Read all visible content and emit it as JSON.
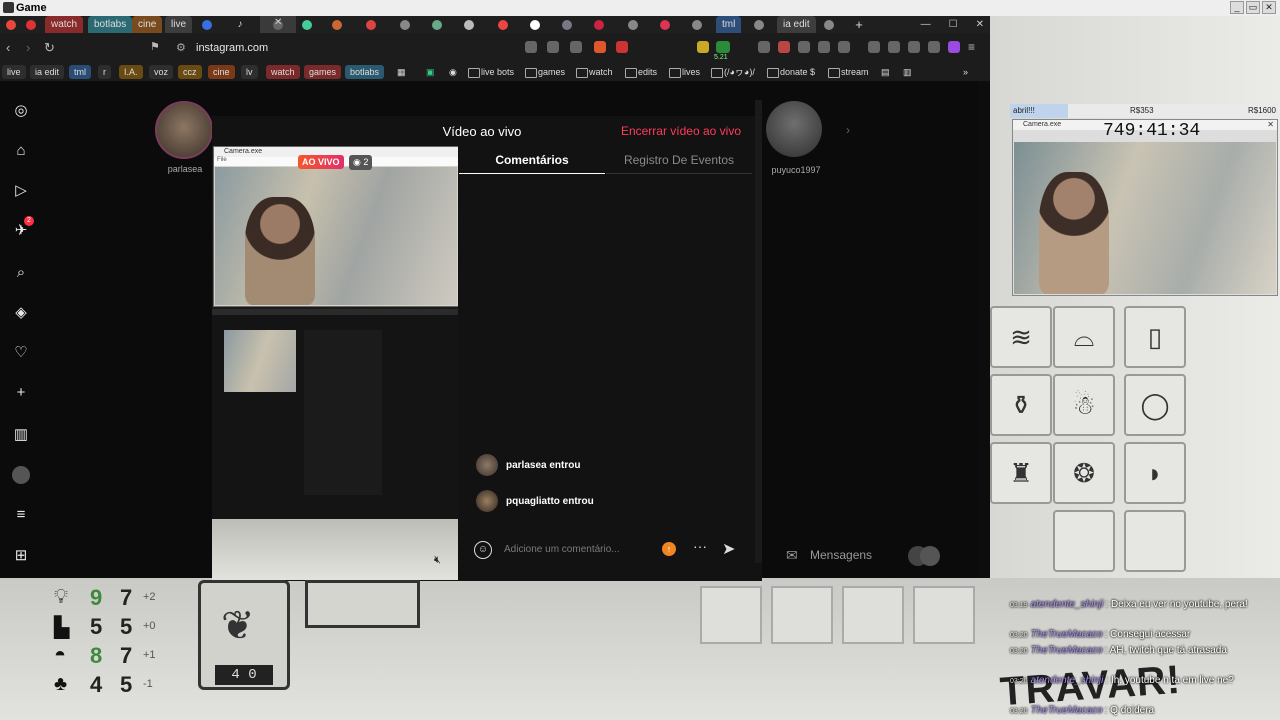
{
  "os": {
    "title": "Game",
    "ctrl_min": "_",
    "ctrl_max": "▭",
    "ctrl_close": "✕"
  },
  "browser": {
    "tabs": [
      "watch",
      "botlabs",
      "cine",
      "live",
      "tml",
      "ia edit"
    ],
    "address": "instagram.com",
    "extension_badge": "5.21",
    "bookmarks": [
      "live",
      "ia edit",
      "tml",
      "r",
      "I.A.",
      "voz",
      "ccz",
      "cine",
      "lv",
      "watch",
      "games",
      "botlabs"
    ],
    "bookmark_folders": [
      "live bots",
      "games",
      "watch",
      "edits",
      "lives",
      "(/◕ヮ◕)/",
      "donate $",
      "stream"
    ]
  },
  "instagram": {
    "story_left_name": "parlasea",
    "story_right_name": "puyuco1997",
    "notification_count": "2",
    "live": {
      "title": "Vídeo ao vivo",
      "end_button": "Encerrar vídeo ao vivo",
      "live_badge": "AO VIVO",
      "viewer_count": "2",
      "camera_window_title": "Camera.exe",
      "camera_menu": "File",
      "tabs": [
        {
          "label": "Comentários",
          "active": true
        },
        {
          "label": "Registro De Eventos",
          "active": false
        }
      ],
      "events": [
        {
          "user": "parlasea entrou"
        },
        {
          "user": "pquagliatto entrou"
        }
      ],
      "comment_placeholder": "Adicione um comentário...",
      "more_icon": "···",
      "send_icon": "➤",
      "up_icon": "↑",
      "emoji_icon": "☺"
    },
    "messages_label": "Mensagens"
  },
  "overlay": {
    "label_a": "abril!!!",
    "label_b": "R$353",
    "label_c": "R$1600",
    "camera_title": "Camera.exe",
    "camera_menu": "File",
    "timer": "749:41:34"
  },
  "game": {
    "stats": [
      {
        "icon": "lightbulb-icon",
        "a": "9",
        "b": "7",
        "delta": "+2",
        "color": "#3d8a3a"
      },
      {
        "icon": "boot-icon",
        "a": "5",
        "b": "5",
        "delta": "+0",
        "color": "#222222"
      },
      {
        "icon": "lips-icon",
        "a": "8",
        "b": "7",
        "delta": "+1",
        "color": "#3d8a3a"
      },
      {
        "icon": "club-icon",
        "a": "4",
        "b": "5",
        "delta": "-1",
        "color": "#222222"
      }
    ],
    "machine_display": "4 0",
    "sign_text": "TRAVAR!"
  },
  "chat": [
    {
      "time": "03:19",
      "user": "atendente_shinji",
      "msg": "Deixa eu ver no youtube, pera!"
    },
    {
      "time": "03:20",
      "user": "TheTrueMacaco",
      "msg": "Consegui acessar"
    },
    {
      "time": "03:20",
      "user": "TheTrueMacaco",
      "msg": "AH, twitch que tá atrasada"
    },
    {
      "time": "03:20",
      "user": "atendente_shinji",
      "msg": "Ih, youtube n ta em live ne?"
    },
    {
      "time": "03:20",
      "user": "TheTrueMacaco",
      "msg": "Q doidera"
    }
  ]
}
